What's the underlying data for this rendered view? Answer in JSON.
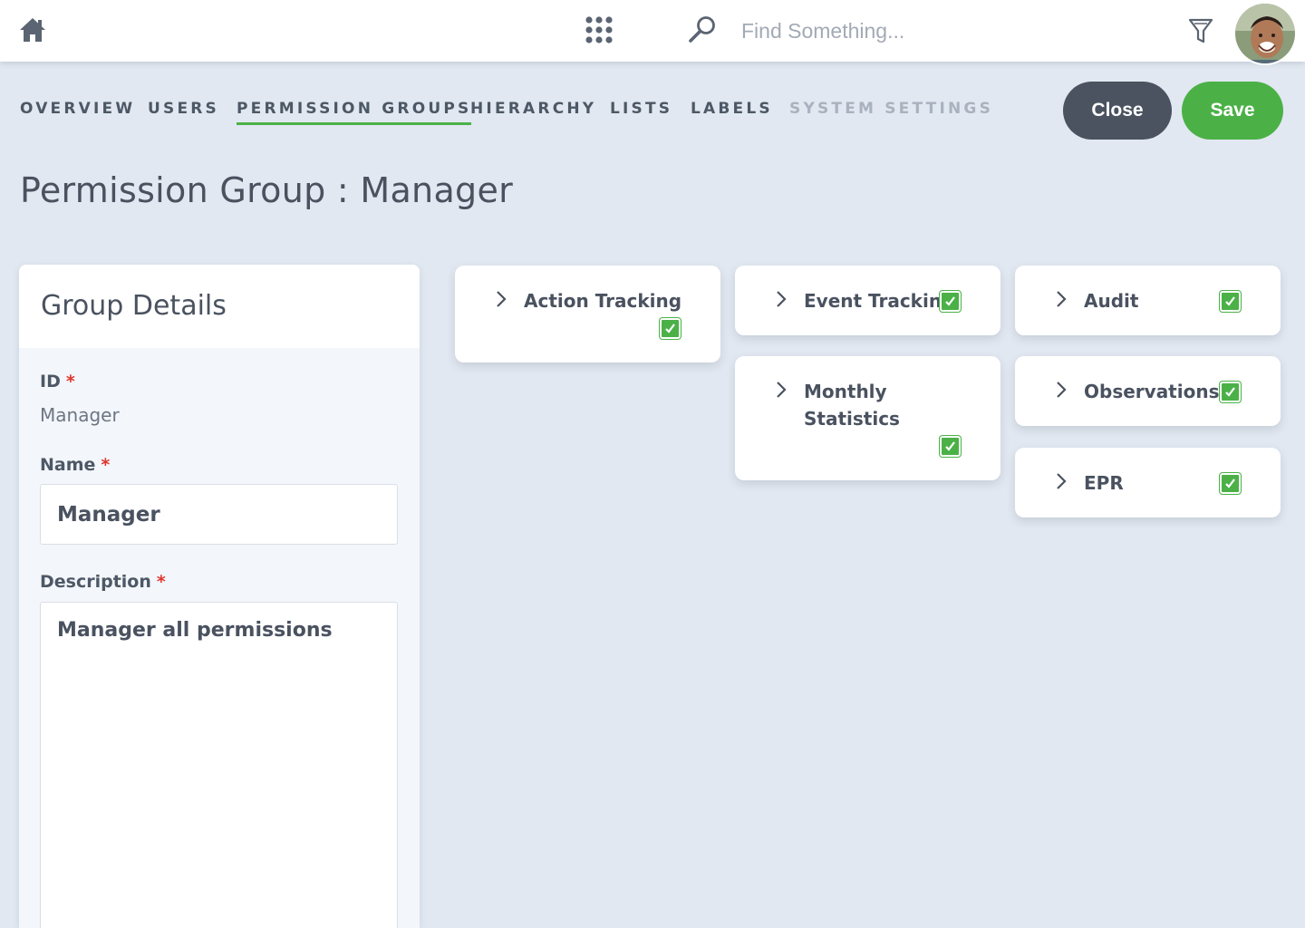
{
  "topbar": {
    "search_placeholder": "Find Something...",
    "icons": [
      "home-icon",
      "apps-grid-icon",
      "search-icon",
      "filter-icon"
    ],
    "avatar": "user-avatar"
  },
  "nav": {
    "tabs": [
      {
        "label": "OVERVIEW"
      },
      {
        "label": "USERS"
      },
      {
        "label": "PERMISSION GROUPS",
        "active": true
      },
      {
        "label": "HIERARCHY"
      },
      {
        "label": "LISTS"
      },
      {
        "label": "LABELS"
      },
      {
        "label": "SYSTEM SETTINGS",
        "disabled": true
      }
    ]
  },
  "actions": {
    "close_label": "Close",
    "save_label": "Save"
  },
  "page": {
    "title": "Permission Group :  Manager"
  },
  "group_details": {
    "heading": "Group Details",
    "id_label": "ID",
    "id_value": "Manager",
    "name_label": "Name",
    "name_value": "Manager",
    "description_label": "Description",
    "description_value": "Manager all permissions",
    "required_marker": "*"
  },
  "permissions": [
    {
      "label": "Action Tracking",
      "checked": true
    },
    {
      "label": "Event Tracking",
      "checked": true
    },
    {
      "label": "Audit",
      "checked": true
    },
    {
      "label": "Monthly Statistics",
      "checked": true
    },
    {
      "label": "Observations",
      "checked": true
    },
    {
      "label": "EPR",
      "checked": true
    }
  ],
  "colors": {
    "accent_green": "#4bb147",
    "close_button": "#4b5360",
    "background": "#e1e8f1",
    "required": "#e1352d"
  }
}
